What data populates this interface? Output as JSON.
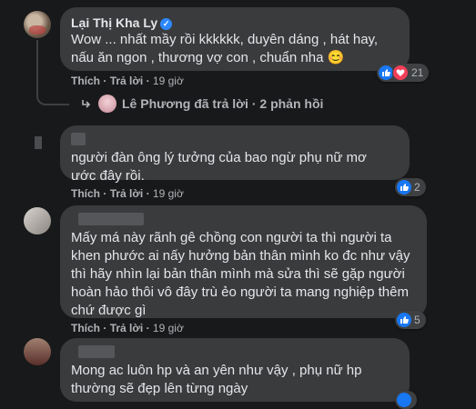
{
  "comments": [
    {
      "author": "Lại Thị Kha Ly",
      "text": "Wow ... nhất mầy rồi kkkkkk, duyên dáng , hát hay, nấu ăn ngon , thương vợ con , chuẩn nha 😊",
      "like_label": "Thích",
      "reply_label": "Trả lời",
      "time": "19 giờ",
      "reaction_count": "21"
    },
    {
      "text": "người đàn ông lý tưởng của bao ngừ phụ nữ mơ ước đây rồi.",
      "like_label": "Thích",
      "reply_label": "Trả lời",
      "time": "19 giờ",
      "reaction_count": "2"
    },
    {
      "text": "Mấy má này rãnh gê chồng con người ta thì người ta khen phước ai nấy hưởng bản thân mình ko đc như vậy thì hãy nhìn lại bản thân mình mà sửa thì sẽ gặp người hoàn hảo thôi vô đây trù ẻo người ta mang nghiệp thêm chứ được gì",
      "like_label": "Thích",
      "reply_label": "Trả lời",
      "time": "19 giờ",
      "reaction_count": "5"
    },
    {
      "text": "Mong ac luôn hp và an yên như vậy , phụ nữ hp thường sẽ đẹp lên từng ngày"
    }
  ],
  "reply_summary": {
    "text": "Lê Phương đã trả lời · 2 phản hồi"
  },
  "separator": "·",
  "colors": {
    "like": "#1877f2",
    "heart": "#f33e58",
    "bubble": "#3a3b3c",
    "background": "#18191a"
  }
}
